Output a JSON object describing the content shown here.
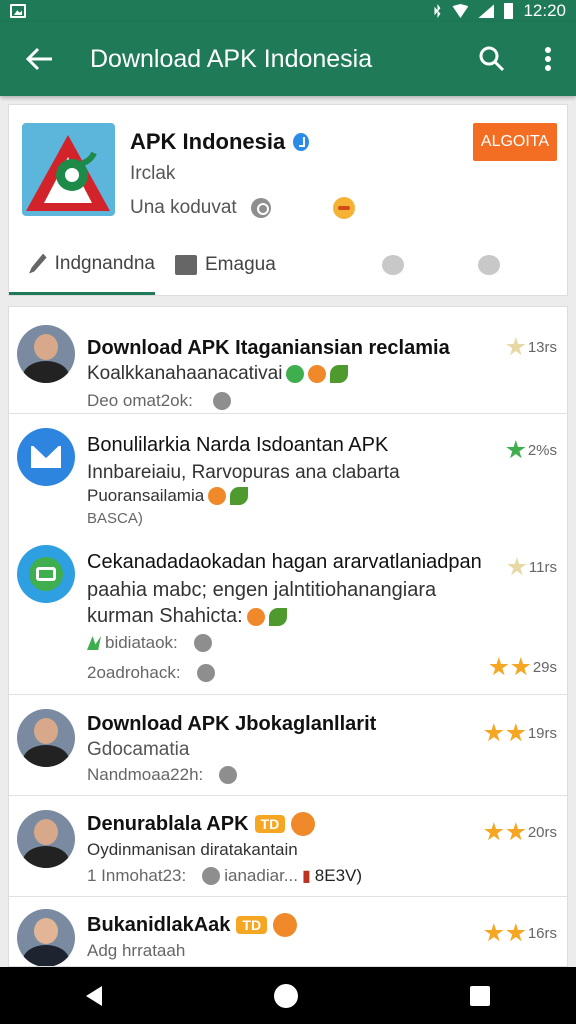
{
  "status_bar": {
    "time": "12:20"
  },
  "app_bar": {
    "title": "Download APK Indonesia"
  },
  "app_card": {
    "name": "APK Indonesia",
    "developer": "Irclak",
    "meta": "Una koduvat",
    "install_label": "ALGOITA",
    "tabs": [
      {
        "label": "Indgnandna",
        "icon": "pen-icon"
      },
      {
        "label": "Emagua",
        "icon": "image-icon"
      },
      {
        "label": "",
        "icon": "share-icon"
      },
      {
        "label": "",
        "icon": "globe-icon"
      }
    ]
  },
  "reviews": [
    {
      "title": "Download APK Itaganiansian reclamia",
      "line1": "Koalkkanahaanacativai",
      "line2": "Deo omat2ok:",
      "rating_text": "13rs",
      "stars": 1,
      "avatar": "person-photo"
    },
    {
      "title": "Bonulilarkia Narda Isdoantan  APK",
      "line1": "Innbareiaiu, Rarvopuras ana clabarta",
      "line2": "Puoransailamia",
      "line3": "BASCA)",
      "rating_text": "2%s",
      "stars": 1,
      "avatar": "mail-app-icon"
    },
    {
      "title": "Cekanadadaokadan hagan ararvatlaniadpan",
      "line1": "paahia mabc; engen jalntitiohanangiara",
      "line2": "kurman Shahicta:",
      "line3": "bidiataok:",
      "line4": "2oadrohack:",
      "rating_text": "11rs",
      "rating_text2": "29s",
      "stars": 2,
      "avatar": "messages-app-icon"
    },
    {
      "title": "Download APK Jbokaglanllarit",
      "line1": "Gdocamatia",
      "line2": "Nandmoaa22h:",
      "rating_text": "19rs",
      "stars": 2,
      "avatar": "person-photo"
    },
    {
      "title": "Denurablala APK",
      "badge": "TD",
      "line1": "Oydinmanisan diratakantain",
      "line2": "1 Inmohat23:",
      "line2b": "ianadiar...",
      "line2c": "8E3V)",
      "rating_text": "20rs",
      "stars": 2,
      "avatar": "person-photo"
    },
    {
      "title": "BukanidlakAak",
      "badge": "TD",
      "line1": "Adg hrrataah",
      "rating_text": "16rs",
      "stars": 2,
      "avatar": "person-photo-female"
    }
  ],
  "colors": {
    "primary": "#1e7a57",
    "accent": "#f36d22",
    "star": "#f5a623"
  }
}
